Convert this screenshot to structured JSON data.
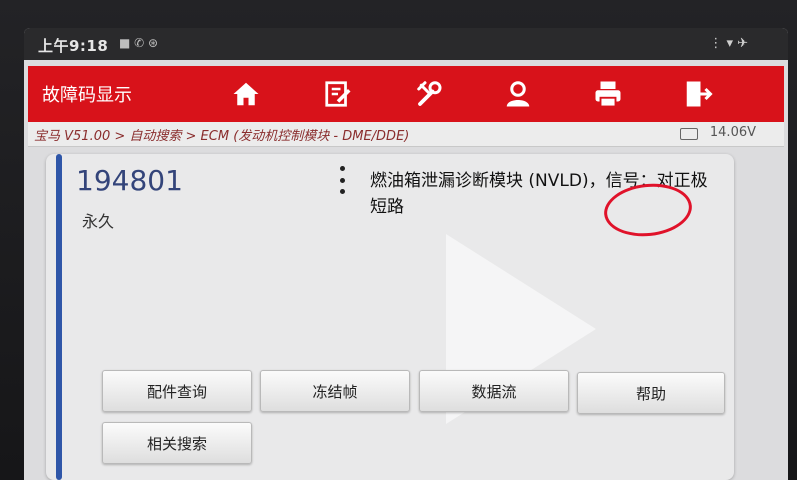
{
  "statusbar": {
    "time": "上午9:18",
    "status_icons": "■ ✆ ⊛",
    "right_icons": "⋮ ▾ ✈"
  },
  "toolbar": {
    "title": "故障码显示",
    "icons": [
      "home-icon",
      "edit-report-icon",
      "diagnostic-icon",
      "user-icon",
      "print-icon",
      "exit-icon"
    ],
    "color": "#d8121a"
  },
  "breadcrumb": {
    "path": "宝马 V51.00 > 自动搜索 > ECM (发动机控制模块 - DME/DDE)",
    "voltage": "14.06V"
  },
  "dtc": {
    "code": "194801",
    "status": "永久",
    "description": "燃油箱泄漏诊断模块 (NVLD)，信号：对正极短路"
  },
  "buttons": {
    "parts_query": "配件查询",
    "freeze_frame": "冻结帧",
    "data_stream": "数据流",
    "help": "帮助",
    "related_search": "相关搜索"
  }
}
